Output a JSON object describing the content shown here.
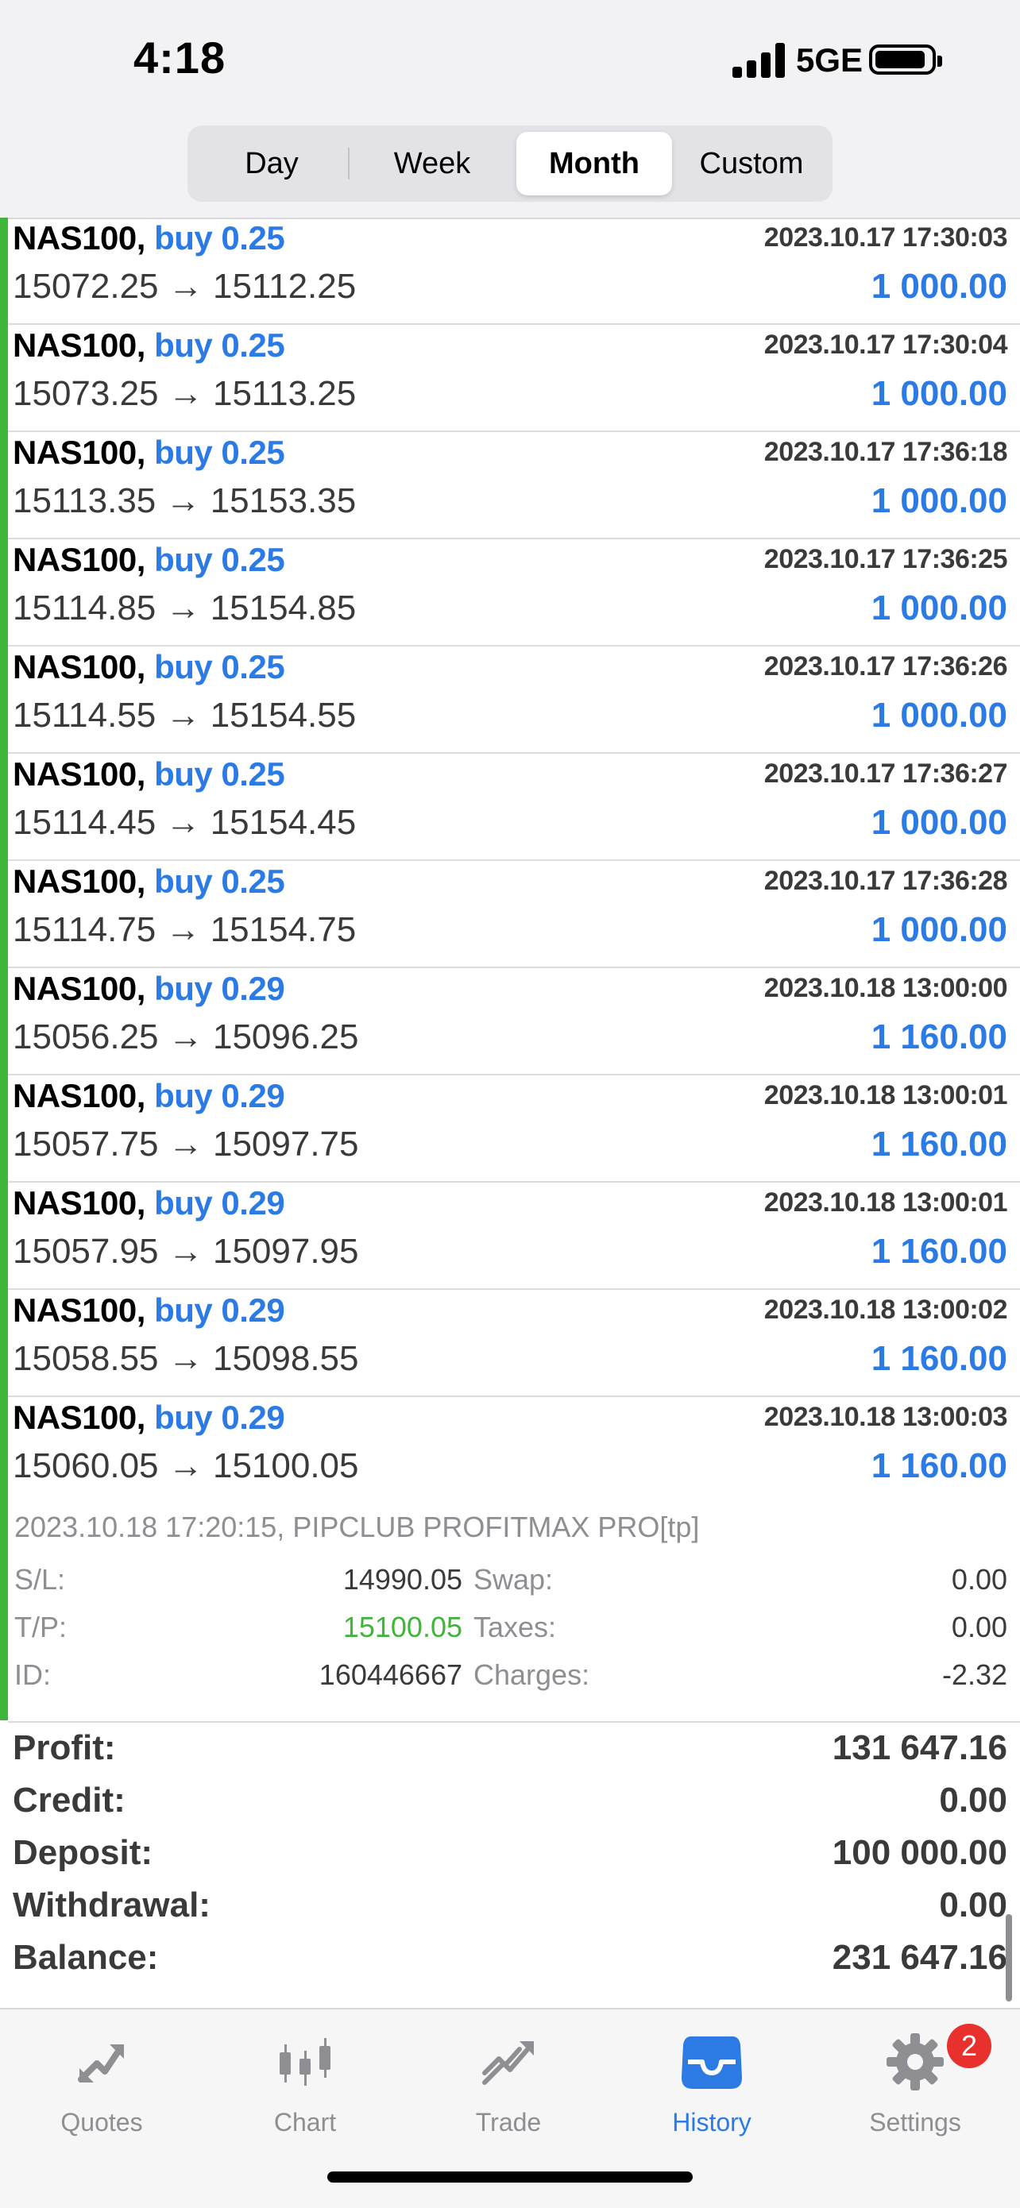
{
  "status_bar": {
    "time": "4:18",
    "network": "5GE"
  },
  "period_tabs": [
    {
      "label": "Day",
      "active": false
    },
    {
      "label": "Week",
      "active": false
    },
    {
      "label": "Month",
      "active": true
    },
    {
      "label": "Custom",
      "active": false
    }
  ],
  "deals": [
    {
      "symbol": "NAS100,",
      "side": "buy 0.25",
      "time": "2023.10.17 17:30:03",
      "prices": "15072.25 → 15112.25",
      "profit": "1 000.00"
    },
    {
      "symbol": "NAS100,",
      "side": "buy 0.25",
      "time": "2023.10.17 17:30:04",
      "prices": "15073.25 → 15113.25",
      "profit": "1 000.00"
    },
    {
      "symbol": "NAS100,",
      "side": "buy 0.25",
      "time": "2023.10.17 17:36:18",
      "prices": "15113.35 → 15153.35",
      "profit": "1 000.00"
    },
    {
      "symbol": "NAS100,",
      "side": "buy 0.25",
      "time": "2023.10.17 17:36:25",
      "prices": "15114.85 → 15154.85",
      "profit": "1 000.00"
    },
    {
      "symbol": "NAS100,",
      "side": "buy 0.25",
      "time": "2023.10.17 17:36:26",
      "prices": "15114.55 → 15154.55",
      "profit": "1 000.00"
    },
    {
      "symbol": "NAS100,",
      "side": "buy 0.25",
      "time": "2023.10.17 17:36:27",
      "prices": "15114.45 → 15154.45",
      "profit": "1 000.00"
    },
    {
      "symbol": "NAS100,",
      "side": "buy 0.25",
      "time": "2023.10.17 17:36:28",
      "prices": "15114.75 → 15154.75",
      "profit": "1 000.00"
    },
    {
      "symbol": "NAS100,",
      "side": "buy 0.29",
      "time": "2023.10.18 13:00:00",
      "prices": "15056.25 → 15096.25",
      "profit": "1 160.00"
    },
    {
      "symbol": "NAS100,",
      "side": "buy 0.29",
      "time": "2023.10.18 13:00:01",
      "prices": "15057.75 → 15097.75",
      "profit": "1 160.00"
    },
    {
      "symbol": "NAS100,",
      "side": "buy 0.29",
      "time": "2023.10.18 13:00:01",
      "prices": "15057.95 → 15097.95",
      "profit": "1 160.00"
    },
    {
      "symbol": "NAS100,",
      "side": "buy 0.29",
      "time": "2023.10.18 13:00:02",
      "prices": "15058.55 → 15098.55",
      "profit": "1 160.00"
    },
    {
      "symbol": "NAS100,",
      "side": "buy 0.29",
      "time": "2023.10.18 13:00:03",
      "prices": "15060.05 → 15100.05",
      "profit": "1 160.00"
    }
  ],
  "detail": {
    "comment": "2023.10.18 17:20:15, PIPCLUB PROFITMAX PRO[tp]",
    "sl_label": "S/L:",
    "sl_value": "14990.05",
    "tp_label": "T/P:",
    "tp_value": "15100.05",
    "id_label": "ID:",
    "id_value": "160446667",
    "swap_label": "Swap:",
    "swap_value": "0.00",
    "taxes_label": "Taxes:",
    "taxes_value": "0.00",
    "charges_label": "Charges:",
    "charges_value": "-2.32"
  },
  "summary": [
    {
      "label": "Profit:",
      "value": "131 647.16"
    },
    {
      "label": "Credit:",
      "value": "0.00"
    },
    {
      "label": "Deposit:",
      "value": "100 000.00"
    },
    {
      "label": "Withdrawal:",
      "value": "0.00"
    },
    {
      "label": "Balance:",
      "value": "231 647.16"
    }
  ],
  "tabbar": {
    "quotes": "Quotes",
    "chart": "Chart",
    "trade": "Trade",
    "history": "History",
    "settings": "Settings",
    "settings_badge": "2",
    "active": "History"
  },
  "colors": {
    "accent": "#2c7be5",
    "profit_bar": "#3fb63a",
    "tp": "#3fb63a",
    "badge": "#e8302c"
  }
}
